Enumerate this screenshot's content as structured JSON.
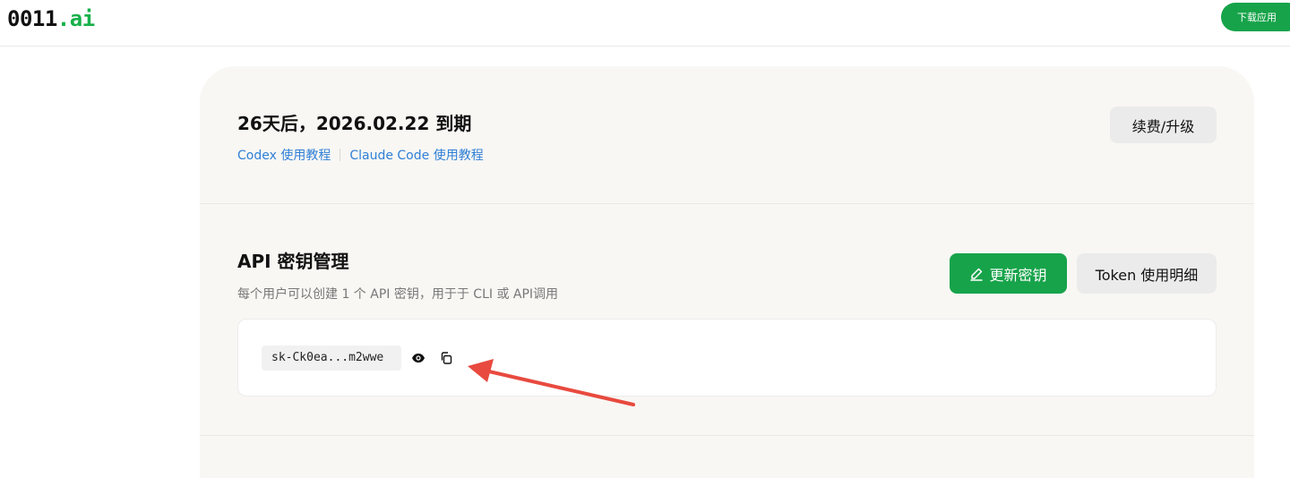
{
  "header": {
    "logo_main": "0011",
    "logo_accent": ".ai",
    "download_label": "下载应用"
  },
  "subscription": {
    "expiry_text": "26天后，2026.02.22 到期",
    "tutorial_links": [
      "Codex 使用教程",
      "Claude Code 使用教程"
    ],
    "renew_label": "续费/升级"
  },
  "api": {
    "title": "API 密钥管理",
    "description": "每个用户可以创建 1 个 API 密钥，用于于 CLI 或 API调用",
    "update_label": "更新密钥",
    "token_label": "Token 使用明细",
    "key_masked": "sk-Ck0ea...m2wwe"
  },
  "colors": {
    "brand_green": "#17a34a",
    "link_blue": "#2f7fd6",
    "annotation_red": "#e84a3f"
  },
  "icons": [
    "edit-icon",
    "eye-icon",
    "copy-icon",
    "annotation-arrow"
  ]
}
